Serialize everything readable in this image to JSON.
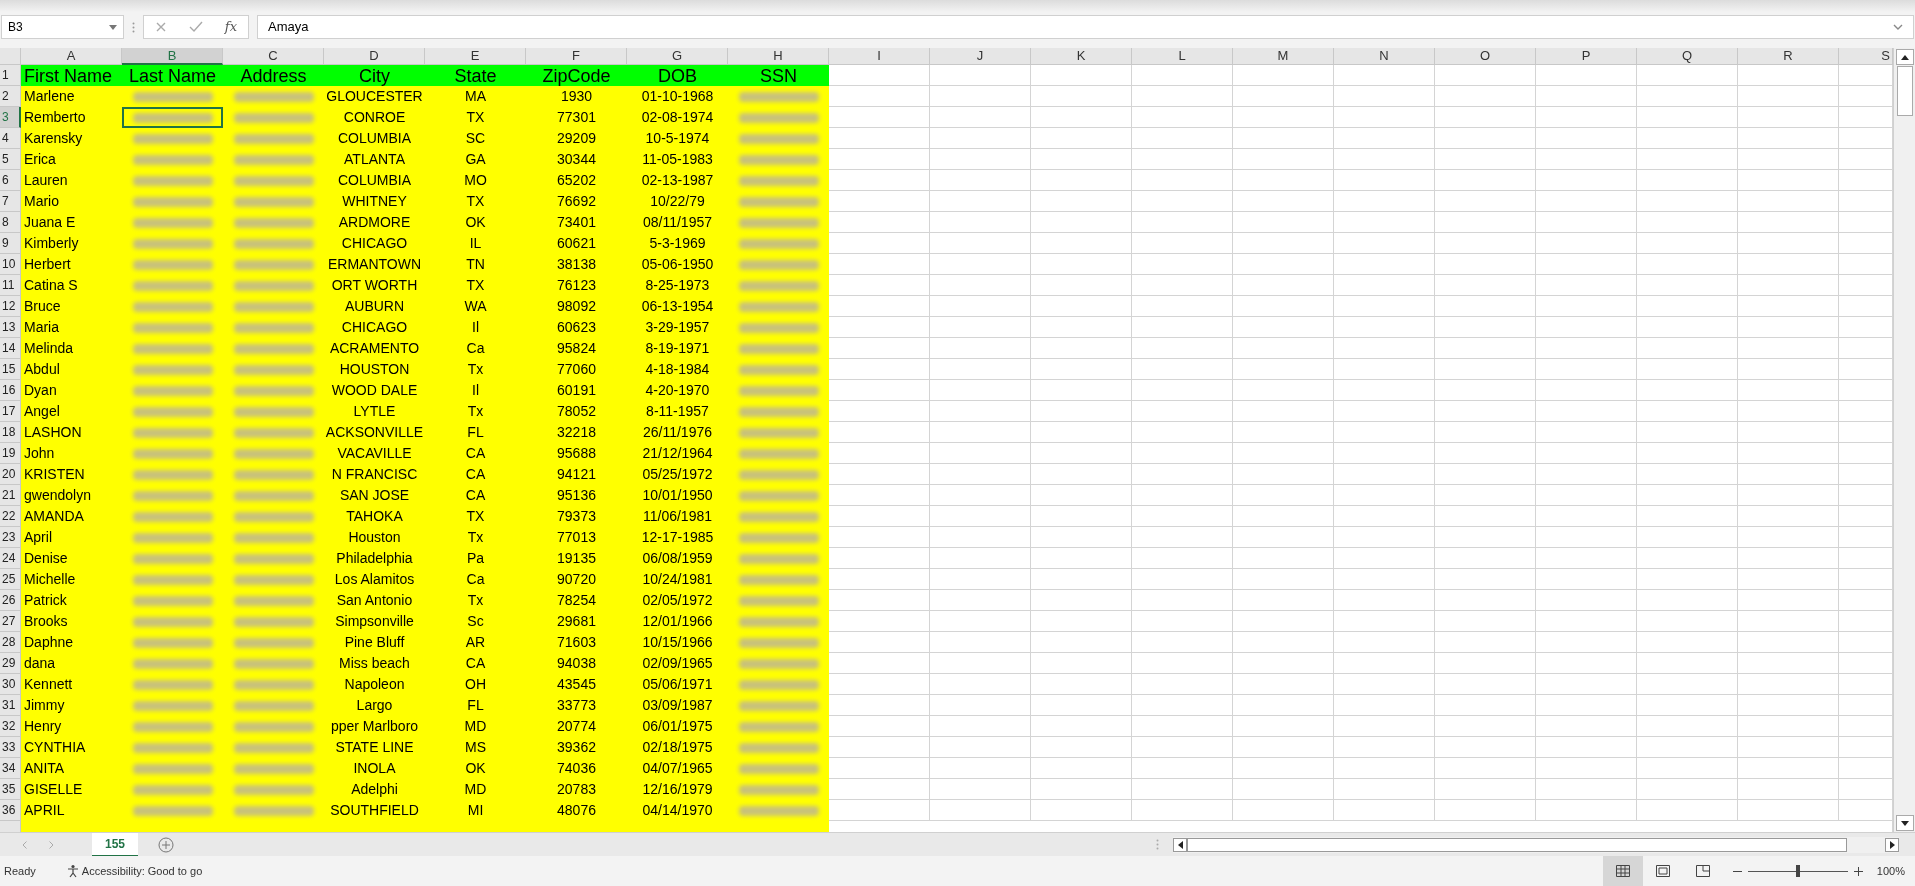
{
  "name_box": "B3",
  "formula": {
    "function_label": "fx",
    "value": "Amaya"
  },
  "columns": [
    {
      "letter": "A",
      "title": "First Name",
      "redacted": false,
      "selected": false
    },
    {
      "letter": "B",
      "title": "Last Name",
      "redacted": true,
      "selected": true
    },
    {
      "letter": "C",
      "title": "Address",
      "redacted": true,
      "selected": false
    },
    {
      "letter": "D",
      "title": "City",
      "redacted": false,
      "selected": false
    },
    {
      "letter": "E",
      "title": "State",
      "redacted": false,
      "selected": false
    },
    {
      "letter": "F",
      "title": "ZipCode",
      "redacted": false,
      "selected": false
    },
    {
      "letter": "G",
      "title": "DOB",
      "redacted": false,
      "selected": false
    },
    {
      "letter": "H",
      "title": "SSN",
      "redacted": true,
      "selected": false
    },
    {
      "letter": "I",
      "selected": false
    },
    {
      "letter": "J",
      "selected": false
    },
    {
      "letter": "K",
      "selected": false
    },
    {
      "letter": "L",
      "selected": false
    },
    {
      "letter": "M",
      "selected": false
    },
    {
      "letter": "N",
      "selected": false
    },
    {
      "letter": "O",
      "selected": false
    },
    {
      "letter": "P",
      "selected": false
    },
    {
      "letter": "Q",
      "selected": false
    },
    {
      "letter": "R",
      "selected": false
    },
    {
      "letter": "S",
      "selected": false
    }
  ],
  "header_row": {
    "number": "1",
    "selected": false
  },
  "rows": [
    {
      "number": "2",
      "selected": false,
      "values": [
        "Marlene",
        "GLOUCESTER",
        "MA",
        "1930",
        "01-10-1968"
      ]
    },
    {
      "number": "3",
      "selected": true,
      "values": [
        "Remberto",
        "CONROE",
        "TX",
        "77301",
        "02-08-1974"
      ]
    },
    {
      "number": "4",
      "selected": false,
      "values": [
        "Karensky",
        "COLUMBIA",
        "SC",
        "29209",
        "10-5-1974"
      ]
    },
    {
      "number": "5",
      "selected": false,
      "values": [
        "Erica",
        "ATLANTA",
        "GA",
        "30344",
        "11-05-1983"
      ]
    },
    {
      "number": "6",
      "selected": false,
      "values": [
        "Lauren",
        "COLUMBIA",
        "MO",
        "65202",
        "02-13-1987"
      ]
    },
    {
      "number": "7",
      "selected": false,
      "values": [
        "Mario",
        "WHITNEY",
        "TX",
        "76692",
        "10/22/79"
      ]
    },
    {
      "number": "8",
      "selected": false,
      "values": [
        "Juana E",
        "ARDMORE",
        "OK",
        "73401",
        "08/11/1957"
      ]
    },
    {
      "number": "9",
      "selected": false,
      "values": [
        "Kimberly",
        "CHICAGO",
        "IL",
        "60621",
        "5-3-1969"
      ]
    },
    {
      "number": "10",
      "selected": false,
      "values": [
        "Herbert",
        "ERMANTOWN",
        "TN",
        "38138",
        "05-06-1950"
      ]
    },
    {
      "number": "11",
      "selected": false,
      "values": [
        "Catina S",
        "ORT WORTH",
        "TX",
        "76123",
        "8-25-1973"
      ]
    },
    {
      "number": "12",
      "selected": false,
      "values": [
        "Bruce",
        "AUBURN",
        "WA",
        "98092",
        "06-13-1954"
      ]
    },
    {
      "number": "13",
      "selected": false,
      "values": [
        "Maria",
        "CHICAGO",
        "Il",
        "60623",
        "3-29-1957"
      ]
    },
    {
      "number": "14",
      "selected": false,
      "values": [
        "Melinda",
        "ACRAMENTO",
        "Ca",
        "95824",
        "8-19-1971"
      ]
    },
    {
      "number": "15",
      "selected": false,
      "values": [
        "Abdul",
        "HOUSTON",
        "Tx",
        "77060",
        "4-18-1984"
      ]
    },
    {
      "number": "16",
      "selected": false,
      "values": [
        "Dyan",
        "WOOD DALE",
        "Il",
        "60191",
        "4-20-1970"
      ]
    },
    {
      "number": "17",
      "selected": false,
      "values": [
        "Angel",
        "LYTLE",
        "Tx",
        "78052",
        "8-11-1957"
      ]
    },
    {
      "number": "18",
      "selected": false,
      "values": [
        "LASHON",
        "ACKSONVILLE",
        "FL",
        "32218",
        "26/11/1976"
      ]
    },
    {
      "number": "19",
      "selected": false,
      "values": [
        "John",
        "VACAVILLE",
        "CA",
        "95688",
        "21/12/1964"
      ]
    },
    {
      "number": "20",
      "selected": false,
      "values": [
        "KRISTEN",
        "N FRANCISC",
        "CA",
        "94121",
        "05/25/1972"
      ]
    },
    {
      "number": "21",
      "selected": false,
      "values": [
        "gwendolyn",
        "SAN JOSE",
        "CA",
        "95136",
        "10/01/1950"
      ]
    },
    {
      "number": "22",
      "selected": false,
      "values": [
        "AMANDA",
        "TAHOKA",
        "TX",
        "79373",
        "11/06/1981"
      ]
    },
    {
      "number": "23",
      "selected": false,
      "values": [
        "April",
        "Houston",
        "Tx",
        "77013",
        "12-17-1985"
      ]
    },
    {
      "number": "24",
      "selected": false,
      "values": [
        "Denise",
        "Philadelphia",
        "Pa",
        "19135",
        "06/08/1959"
      ]
    },
    {
      "number": "25",
      "selected": false,
      "values": [
        "Michelle",
        "Los Alamitos",
        "Ca",
        "90720",
        "10/24/1981"
      ]
    },
    {
      "number": "26",
      "selected": false,
      "values": [
        "Patrick",
        "San Antonio",
        "Tx",
        "78254",
        "02/05/1972"
      ]
    },
    {
      "number": "27",
      "selected": false,
      "values": [
        "Brooks",
        "Simpsonville",
        "Sc",
        "29681",
        "12/01/1966"
      ]
    },
    {
      "number": "28",
      "selected": false,
      "values": [
        "Daphne",
        "Pine Bluff",
        "AR",
        "71603",
        "10/15/1966"
      ]
    },
    {
      "number": "29",
      "selected": false,
      "values": [
        "dana",
        "Miss beach",
        "CA",
        "94038",
        "02/09/1965"
      ]
    },
    {
      "number": "30",
      "selected": false,
      "values": [
        "Kennett",
        "Napoleon",
        "OH",
        "43545",
        "05/06/1971"
      ]
    },
    {
      "number": "31",
      "selected": false,
      "values": [
        "Jimmy",
        "Largo",
        "FL",
        "33773",
        "03/09/1987"
      ]
    },
    {
      "number": "32",
      "selected": false,
      "values": [
        "Henry",
        "pper Marlboro",
        "MD",
        "20774",
        "06/01/1975"
      ]
    },
    {
      "number": "33",
      "selected": false,
      "values": [
        "CYNTHIA",
        "STATE LINE",
        "MS",
        "39362",
        "02/18/1975"
      ]
    },
    {
      "number": "34",
      "selected": false,
      "values": [
        "ANITA",
        "INOLA",
        "OK",
        "74036",
        "04/07/1965"
      ]
    },
    {
      "number": "35",
      "selected": false,
      "values": [
        "GISELLE",
        "Adelphi",
        "MD",
        "20783",
        "12/16/1979"
      ]
    },
    {
      "number": "36",
      "selected": false,
      "values": [
        "APRIL",
        "SOUTHFIELD",
        "MI",
        "48076",
        "04/14/1970"
      ]
    }
  ],
  "sheet_tabs": [
    {
      "label": "155",
      "selected": true
    }
  ],
  "status_bar": {
    "mode": "Ready",
    "accessibility": "Accessibility: Good to go",
    "views": [
      {
        "kind": "normal",
        "selected": true
      },
      {
        "kind": "page-layout",
        "selected": false
      },
      {
        "kind": "page-break",
        "selected": false
      }
    ],
    "zoom": {
      "level": 0.5,
      "reading": "100%"
    }
  }
}
